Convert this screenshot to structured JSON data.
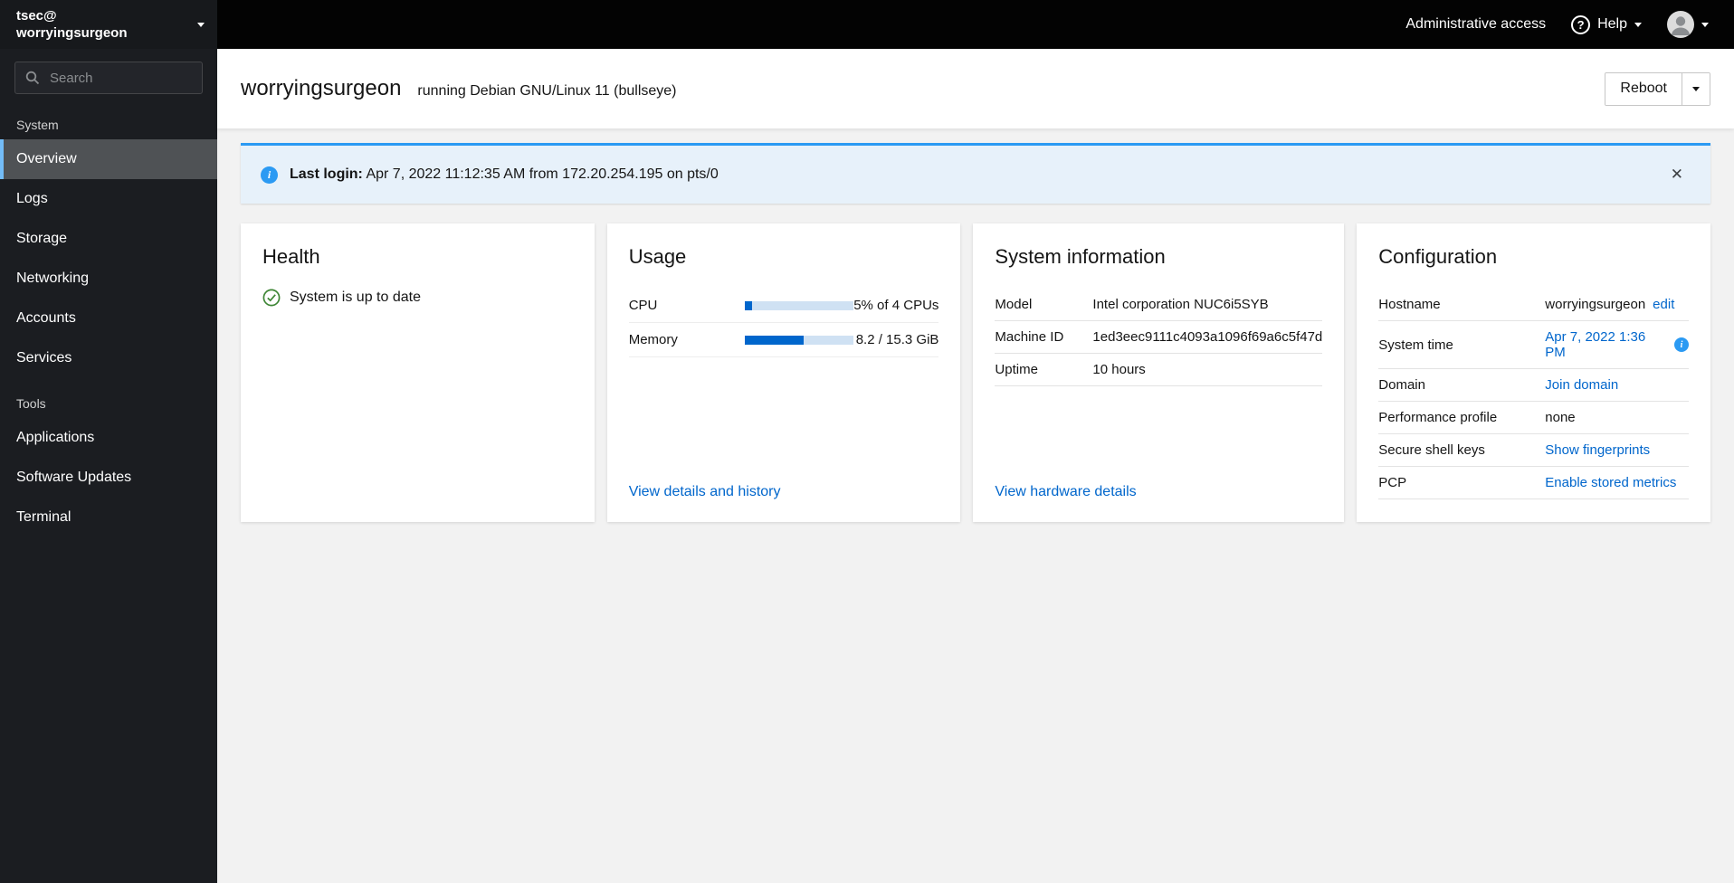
{
  "masthead": {
    "admin_access": "Administrative access",
    "help": "Help"
  },
  "sidebar": {
    "host_user": "tsec@",
    "host_name": "worryingsurgeon",
    "search_placeholder": "Search",
    "section_system": "System",
    "section_tools": "Tools",
    "nav_system": [
      "Overview",
      "Logs",
      "Storage",
      "Networking",
      "Accounts",
      "Services"
    ],
    "nav_tools": [
      "Applications",
      "Software Updates",
      "Terminal"
    ]
  },
  "header": {
    "hostname": "worryingsurgeon",
    "os_text": "running Debian GNU/Linux 11 (bullseye)",
    "reboot": "Reboot"
  },
  "alert": {
    "label": "Last login:",
    "message": "Apr 7, 2022 11:12:35 AM from 172.20.254.195 on pts/0"
  },
  "cards": {
    "health": {
      "title": "Health",
      "status": "System is up to date"
    },
    "usage": {
      "title": "Usage",
      "cpu_label": "CPU",
      "cpu_value": "5% of 4 CPUs",
      "cpu_percent": 7,
      "memory_label": "Memory",
      "memory_value": "8.2 / 15.3 GiB",
      "memory_percent": 54,
      "link": "View details and history"
    },
    "system_info": {
      "title": "System information",
      "rows": [
        {
          "label": "Model",
          "value": "Intel corporation NUC6i5SYB"
        },
        {
          "label": "Machine ID",
          "value": "1ed3eec9111c4093a1096f69a6c5f47d"
        },
        {
          "label": "Uptime",
          "value": "10 hours"
        }
      ],
      "link": "View hardware details"
    },
    "configuration": {
      "title": "Configuration",
      "hostname_label": "Hostname",
      "hostname_value": "worryingsurgeon",
      "hostname_edit": "edit",
      "time_label": "System time",
      "time_value": "Apr 7, 2022 1:36 PM",
      "domain_label": "Domain",
      "domain_link": "Join domain",
      "profile_label": "Performance profile",
      "profile_value": "none",
      "ssh_label": "Secure shell keys",
      "ssh_link": "Show fingerprints",
      "pcp_label": "PCP",
      "pcp_link": "Enable stored metrics"
    }
  },
  "colors": {
    "accent_link": "#0066cc",
    "info_blue": "#2b9af3",
    "success_green": "#3e8635",
    "nav_active_accent": "#73bcf7",
    "progress_fill": "#0066cc",
    "progress_track": "#cfe1f3",
    "masthead_bg": "#030303",
    "sidebar_bg": "#1b1d21",
    "content_bg": "#f2f2f2"
  }
}
